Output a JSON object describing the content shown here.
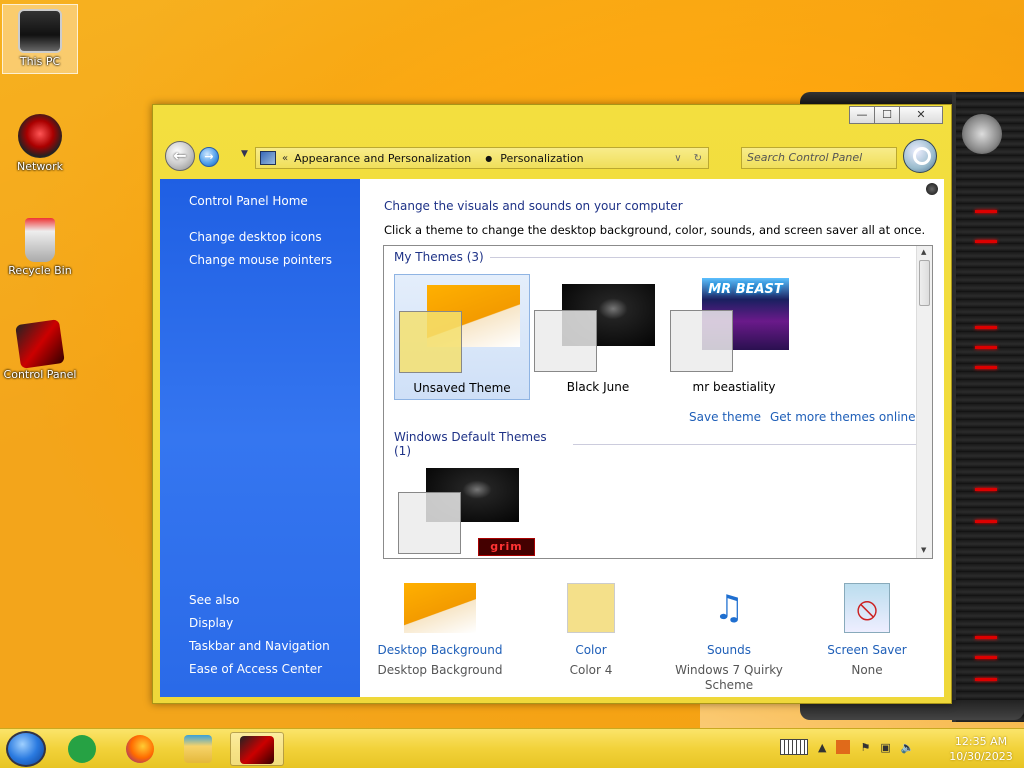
{
  "desktop": {
    "icons": [
      {
        "label": "This PC"
      },
      {
        "label": "Network"
      },
      {
        "label": "Recycle Bin"
      },
      {
        "label": "Control Panel"
      }
    ]
  },
  "window": {
    "controls": {
      "minimize": "—",
      "maximize": "☐",
      "close": "✕"
    },
    "address": {
      "chevrons": "«",
      "items": [
        "Appearance and Personalization",
        "Personalization"
      ],
      "separator": "●"
    },
    "search": {
      "placeholder": "Search Control Panel"
    },
    "left_pane": {
      "home": "Control Panel Home",
      "tasks": [
        "Change desktop icons",
        "Change mouse pointers"
      ],
      "see_also_heading": "See also",
      "see_also": [
        "Display",
        "Taskbar and Navigation",
        "Ease of Access Center"
      ]
    },
    "content": {
      "title": "Change the visuals and sounds on your computer",
      "description": "Click a theme to change the desktop background, color, sounds, and screen saver all at once.",
      "my_themes_heading": "My Themes (3)",
      "my_themes": [
        {
          "name": "Unsaved Theme",
          "selected": true
        },
        {
          "name": "Black June",
          "selected": false
        },
        {
          "name": "mr beastiality",
          "selected": false
        }
      ],
      "save_theme": "Save theme",
      "get_more": "Get more themes online",
      "default_themes_heading": "Windows Default Themes (1)",
      "default_theme_badge": "grim",
      "beast_art_text": "MR BEAST",
      "options": [
        {
          "title": "Desktop Background",
          "subtitle": "Desktop Background"
        },
        {
          "title": "Color",
          "subtitle": "Color 4"
        },
        {
          "title": "Sounds",
          "subtitle": "Windows 7 Quirky Scheme"
        },
        {
          "title": "Screen Saver",
          "subtitle": "None"
        }
      ]
    }
  },
  "taskbar": {
    "clock_time": "12:35 AM",
    "clock_date": "10/30/2023"
  },
  "colors": {
    "window_frame": "#efd83a",
    "left_pane": "#2a6ae8",
    "link": "#1f5fb8",
    "heading": "#1e3287"
  }
}
